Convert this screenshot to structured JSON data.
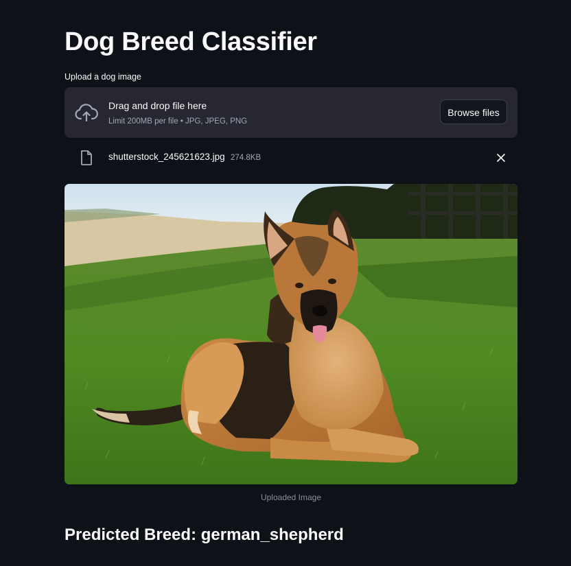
{
  "page": {
    "title": "Dog Breed Classifier"
  },
  "uploader": {
    "label": "Upload a dog image",
    "drop_title": "Drag and drop file here",
    "drop_subtitle": "Limit 200MB per file • JPG, JPEG, PNG",
    "browse_label": "Browse files"
  },
  "uploaded_file": {
    "name": "shutterstock_245621623.jpg",
    "size": "274.8KB"
  },
  "image": {
    "caption": "Uploaded Image",
    "subject": "german shepherd dog lying on grass"
  },
  "result": {
    "text": "Predicted Breed: german_shepherd"
  },
  "icons": {
    "upload": "cloud-upload-icon",
    "file": "file-icon",
    "remove": "close-icon"
  },
  "colors": {
    "background": "#0e1117",
    "dropzone": "#262730",
    "text": "#fafafa",
    "muted": "#a3a8b8"
  }
}
